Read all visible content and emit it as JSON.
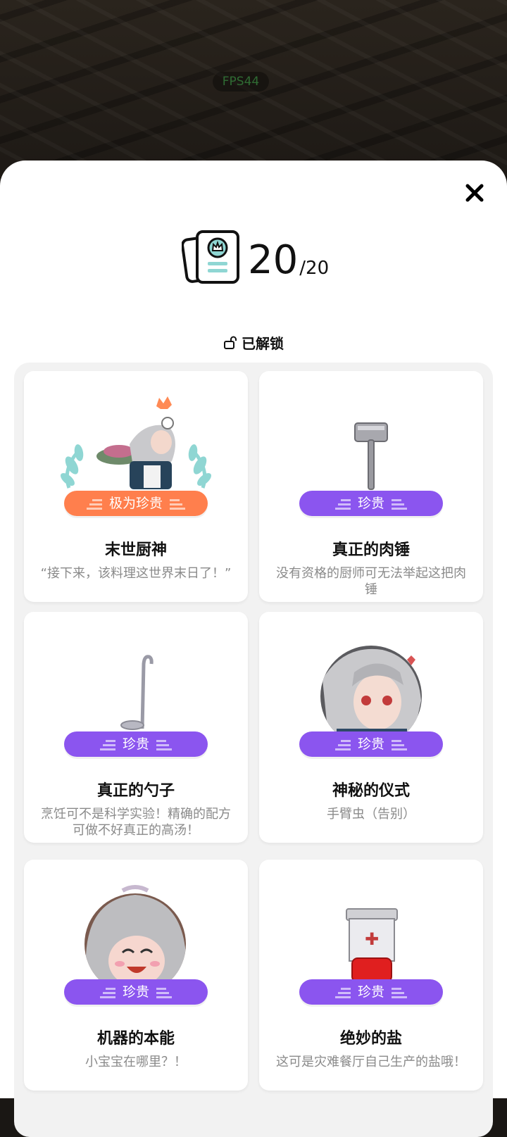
{
  "overlay": {
    "fps": "FPS44"
  },
  "header": {
    "count": "20",
    "total": "/20",
    "section_label": "已解锁"
  },
  "cards": [
    {
      "name": "末世厨神",
      "desc": "“接下来，该料理这世界末日了！”",
      "rarity": "极为珍贵",
      "icon": "chef-character-icon"
    },
    {
      "name": "真正的肉锤",
      "desc": "没有资格的厨师可无法举起这把肉锤",
      "rarity": "珍贵",
      "icon": "meat-mallet-icon"
    },
    {
      "name": "真正的勺子",
      "desc": "烹饪可不是科学实验！精确的配方可做不好真正的高汤！",
      "rarity": "珍贵",
      "icon": "ladle-icon"
    },
    {
      "name": "神秘的仪式",
      "desc": "手臂虫（告别）",
      "rarity": "珍贵",
      "icon": "character-portrait-icon"
    },
    {
      "name": "机器的本能",
      "desc": "小宝宝在哪里？！",
      "rarity": "珍贵",
      "icon": "laughing-character-icon"
    },
    {
      "name": "绝妙的盐",
      "desc": "这可是灾难餐厅自己生产的盐哦！",
      "rarity": "珍贵",
      "icon": "salt-shaker-icon"
    }
  ],
  "colors": {
    "rare": "#8b55ef",
    "very_rare": "#ff7f4d",
    "accent_teal": "#8fd6d3"
  }
}
